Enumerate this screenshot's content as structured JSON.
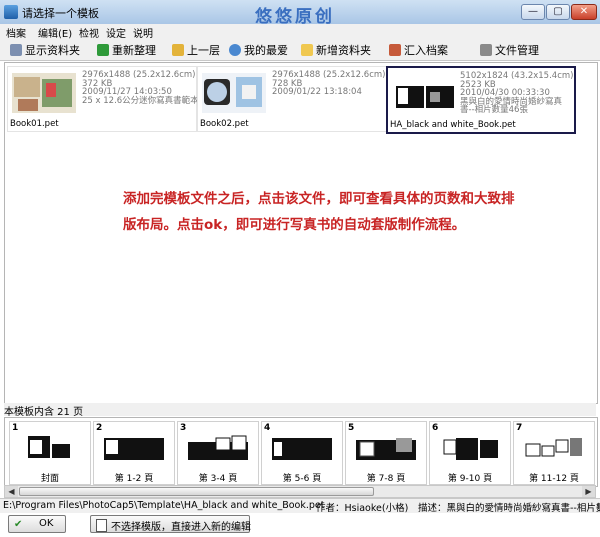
{
  "window": {
    "title": "请选择一个模板",
    "watermark": "悠悠原创",
    "controls": {
      "minimize": "—",
      "maximize": "▢",
      "close": "✕"
    }
  },
  "menu": [
    "档案",
    "编辑(E)",
    "检视",
    "设定",
    "说明"
  ],
  "toolbar": {
    "show_folder": "显示资料夹",
    "reorganize": "重新整理",
    "up_level": "上一层",
    "favorites": "我的最爱",
    "new_folder": "新增资料夹",
    "import": "汇入档案",
    "file_manager": "文件管理"
  },
  "templates": [
    {
      "dims": "2976x1488 (25.2x12.6cm)",
      "size": "372 KB",
      "date": "2009/11/27 14:03:50",
      "desc": "25 x 12.6公分迷你寫真書範本",
      "filename": "Book01.pet"
    },
    {
      "dims": "2976x1488 (25.2x12.6cm)",
      "size": "728 KB",
      "date": "2009/01/22 13:18:04",
      "desc": "",
      "filename": "Book02.pet"
    },
    {
      "dims": "5102x1824 (43.2x15.4cm)",
      "size": "2523 KB",
      "date": "2010/04/30 00:33:30",
      "desc": "黑與白的愛情時尚婚紗寫真書--相片數量46張",
      "filename": "HA_black and white_Book.pet"
    }
  ],
  "instruction": "添加完模板文件之后，点击该文件，即可查看具体的页数和大致排版布局。点击ok，即可进行写真书的自动套版制作流程。",
  "pages_header": "本模板内含 21 页",
  "pages": [
    {
      "num": "1",
      "label": "封面"
    },
    {
      "num": "2",
      "label": "第 1-2 頁"
    },
    {
      "num": "3",
      "label": "第 3-4 頁"
    },
    {
      "num": "4",
      "label": "第 5-6 頁"
    },
    {
      "num": "5",
      "label": "第 7-8 頁"
    },
    {
      "num": "6",
      "label": "第 9-10 頁"
    },
    {
      "num": "7",
      "label": "第 11-12 頁"
    }
  ],
  "scrollbar": {
    "left": "◀",
    "right": "▶"
  },
  "status": {
    "path": "E:\\Program Files\\PhotoCap5\\Template\\HA_black and white_Book.pet",
    "author": "作者：Hsiaoke(小格)",
    "description": "描述：黑與白的愛情時尚婚紗寫真書--相片數量"
  },
  "buttons": {
    "ok": "OK",
    "ok_icon": "✔",
    "skip": "不选择模版，直接进入新的编辑"
  },
  "colors": {
    "instruction": "#c82424",
    "watermark": "#3a6fc0",
    "selection": "#1a1a4a"
  }
}
